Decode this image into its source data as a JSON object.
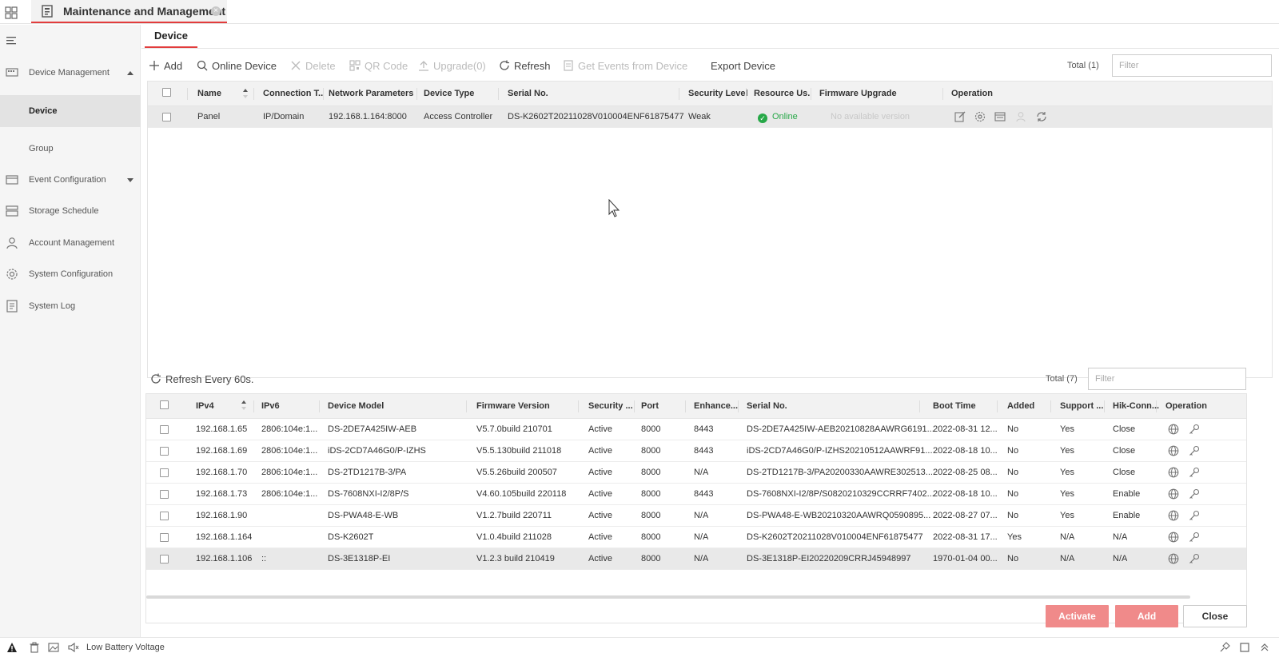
{
  "app": {
    "tab_title": "Maintenance and Management",
    "accent_color": "#e23c3c"
  },
  "sidebar": {
    "items": [
      {
        "label": "Device Management",
        "icon": "device-management-icon",
        "expanded": true
      },
      {
        "label": "Device",
        "active": true
      },
      {
        "label": "Group"
      },
      {
        "label": "Event Configuration",
        "icon": "event-configuration-icon",
        "expanded": false
      },
      {
        "label": "Storage Schedule",
        "icon": "storage-schedule-icon"
      },
      {
        "label": "Account Management",
        "icon": "account-icon"
      },
      {
        "label": "System Configuration",
        "icon": "gear-icon"
      },
      {
        "label": "System Log",
        "icon": "system-log-icon"
      }
    ]
  },
  "page": {
    "tab": "Device"
  },
  "toolbar": {
    "add": "Add",
    "online_device": "Online Device",
    "delete": "Delete",
    "qr_code": "QR Code",
    "upgrade": "Upgrade(0)",
    "refresh": "Refresh",
    "get_events": "Get Events from Device",
    "export": "Export Device",
    "total": "Total (1)",
    "filter_placeholder": "Filter"
  },
  "device_table": {
    "columns": [
      "Name",
      "Connection T...",
      "Network Parameters",
      "Device Type",
      "Serial No.",
      "Security Level",
      "Resource Us...",
      "Firmware Upgrade",
      "Operation"
    ],
    "rows": [
      {
        "name": "Panel",
        "connection": "IP/Domain",
        "network": "192.168.1.164:8000",
        "type": "Access Controller",
        "serial": "DS-K2602T20211028V010004ENF61875477",
        "security": "Weak",
        "resource": "Online",
        "firmware": "No available version"
      }
    ]
  },
  "online_section": {
    "refresh_label": "Refresh Every 60s.",
    "total": "Total (7)",
    "filter_placeholder": "Filter",
    "columns": [
      "IPv4",
      "IPv6",
      "Device Model",
      "Firmware Version",
      "Security ...",
      "Port",
      "Enhance...",
      "Serial No.",
      "Boot Time",
      "Added",
      "Support ...",
      "Hik-Conn...",
      "Operation"
    ],
    "rows": [
      [
        "192.168.1.65",
        "2806:104e:1...",
        "DS-2DE7A425IW-AEB",
        "V5.7.0build 210701",
        "Active",
        "8000",
        "8443",
        "DS-2DE7A425IW-AEB20210828AAWRG6191...",
        "2022-08-31 12...",
        "No",
        "Yes",
        "Close"
      ],
      [
        "192.168.1.69",
        "2806:104e:1...",
        "iDS-2CD7A46G0/P-IZHS",
        "V5.5.130build 211018",
        "Active",
        "8000",
        "8443",
        "iDS-2CD7A46G0/P-IZHS20210512AAWRF91...",
        "2022-08-18 10...",
        "No",
        "Yes",
        "Close"
      ],
      [
        "192.168.1.70",
        "2806:104e:1...",
        "DS-2TD1217B-3/PA",
        "V5.5.26build 200507",
        "Active",
        "8000",
        "N/A",
        "DS-2TD1217B-3/PA20200330AAWRE302513...",
        "2022-08-25 08...",
        "No",
        "Yes",
        "Close"
      ],
      [
        "192.168.1.73",
        "2806:104e:1...",
        "DS-7608NXI-I2/8P/S",
        "V4.60.105build 220118",
        "Active",
        "8000",
        "8443",
        "DS-7608NXI-I2/8P/S0820210329CCRRF7402...",
        "2022-08-18 10...",
        "No",
        "Yes",
        "Enable"
      ],
      [
        "192.168.1.90",
        "",
        "DS-PWA48-E-WB",
        "V1.2.7build 220711",
        "Active",
        "8000",
        "N/A",
        "DS-PWA48-E-WB20210320AAWRQ0590895...",
        "2022-08-27 07...",
        "No",
        "Yes",
        "Enable"
      ],
      [
        "192.168.1.164",
        "",
        "DS-K2602T",
        "V1.0.4build 211028",
        "Active",
        "8000",
        "N/A",
        "DS-K2602T20211028V010004ENF61875477",
        "2022-08-31 17...",
        "Yes",
        "N/A",
        "N/A"
      ],
      [
        "192.168.1.106",
        "::",
        "DS-3E1318P-EI",
        "V1.2.3 build 210419",
        "Active",
        "8000",
        "N/A",
        "DS-3E1318P-EI20220209CRRJ45948997",
        "1970-01-04 00...",
        "No",
        "N/A",
        "N/A"
      ]
    ],
    "selected_row": 6
  },
  "footer_buttons": {
    "activate": "Activate",
    "add": "Add",
    "close": "Close"
  },
  "statusbar": {
    "message": "Low Battery Voltage"
  }
}
